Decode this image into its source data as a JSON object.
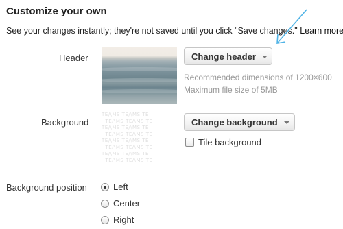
{
  "section": {
    "title": "Customize your own",
    "subtitle": "See your changes instantly; they're not saved until you click \"Save changes.\"",
    "learn_more": "Learn more."
  },
  "header": {
    "label": "Header",
    "button_label": "Change header",
    "hint_dimensions": "Recommended dimensions of 1200×600",
    "hint_size": "Maximum file size of 5MB"
  },
  "background": {
    "label": "Background",
    "button_label": "Change background",
    "tile_label": "Tile background",
    "tile_checked": false,
    "pattern_text": "TE/\\MS TE/\\MS TE"
  },
  "background_position": {
    "label": "Background position",
    "options": [
      {
        "label": "Left",
        "checked": true
      },
      {
        "label": "Center",
        "checked": false
      },
      {
        "label": "Right",
        "checked": false
      }
    ]
  },
  "colors": {
    "arrow": "#4fb3e6"
  }
}
